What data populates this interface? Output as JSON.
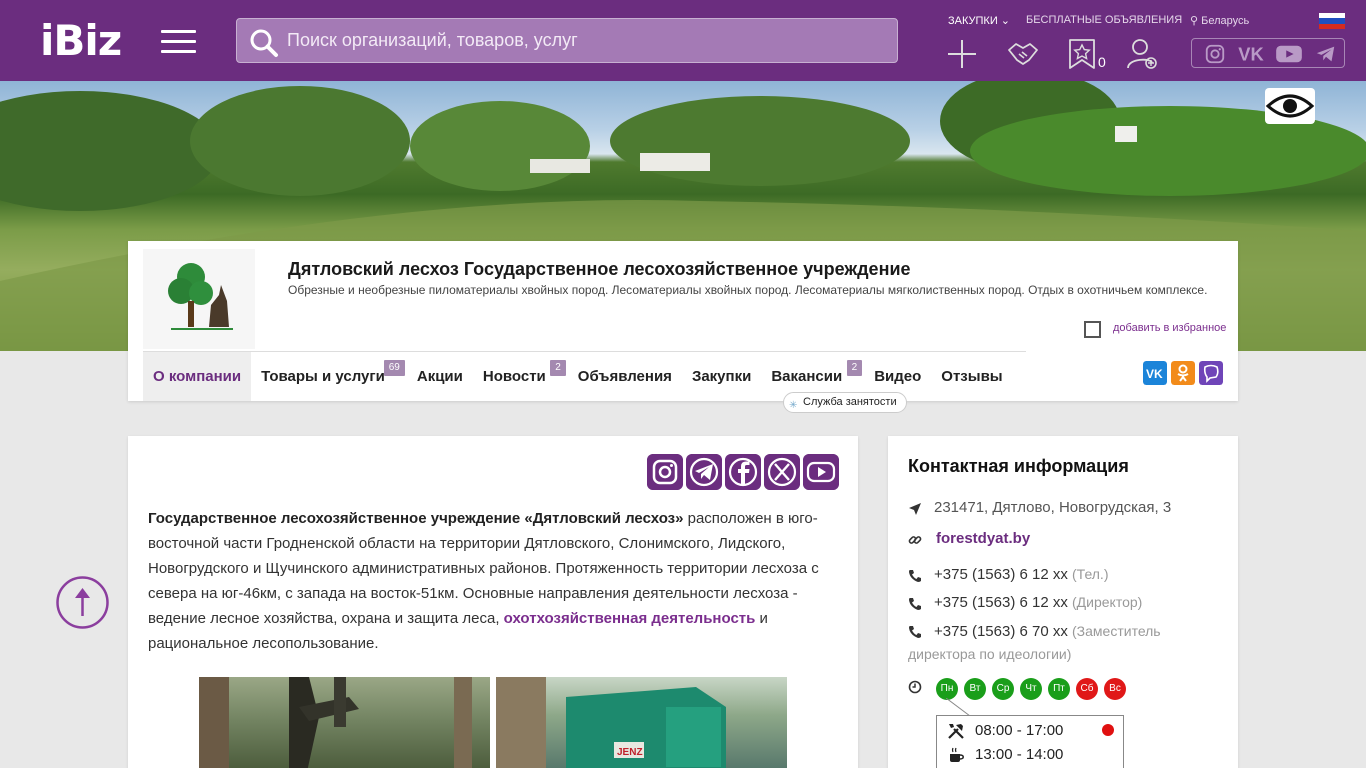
{
  "header": {
    "logo": "iBiz",
    "search_placeholder": "Поиск организаций, товаров, услуг",
    "links": {
      "purchases": "ЗАКУПКИ",
      "free_ads": "БЕСПЛАТНЫЕ ОБЪЯВЛЕНИЯ",
      "region": "Беларусь"
    },
    "favorites_count": "0",
    "socials": [
      "instagram-icon",
      "vk-icon",
      "youtube-icon",
      "telegram-icon"
    ]
  },
  "company": {
    "name": "Дятловский лесхоз Государственное лесохозяйственное учреждение",
    "description": "Обрезные и необрезные пиломатериалы хвойных пород. Лесоматериалы хвойных пород. Лесоматериалы мягколиственных пород. Отдых в охотничьем комплексе.",
    "add_favorite": "добавить в избранное",
    "employment_tag": "Служба занятости"
  },
  "nav": [
    {
      "label": "О компании",
      "badge": ""
    },
    {
      "label": "Товары и услуги",
      "badge": "69"
    },
    {
      "label": "Акции",
      "badge": ""
    },
    {
      "label": "Новости",
      "badge": "2"
    },
    {
      "label": "Объявления",
      "badge": ""
    },
    {
      "label": "Закупки",
      "badge": ""
    },
    {
      "label": "Вакансии",
      "badge": "2"
    },
    {
      "label": "Видео",
      "badge": ""
    },
    {
      "label": "Отзывы",
      "badge": ""
    }
  ],
  "about": {
    "bold": "Государственное лесохозяйственное учреждение «Дятловский лесхоз»",
    "text1": " расположен в юго-восточной части Гродненской области на территории Дятловского, Слонимского, Лидского, Новогрудского и Щучинского административных районов. Протяженность территории лесхоза с севера на юг-46км, с запада на восток-51км. Основные направления деятельности лесхоза - ведение лесное хозяйства, охрана и защита леса, ",
    "link": "охотхозяйственная деятельность",
    "text2": " и рациональное лесопользование."
  },
  "contacts": {
    "title": "Контактная информация",
    "address": "231471, Дятлово, Новогрудская, 3",
    "website": "forestdyat.by",
    "phones": [
      {
        "number": "+375 (1563) 6 12 xx",
        "note": "(Тел.)"
      },
      {
        "number": "+375 (1563) 6 12 xx",
        "note": "(Директор)"
      },
      {
        "number": "+375 (1563) 6 70 xx",
        "note": "(Заместитель директора по идеологии)"
      }
    ],
    "days": [
      {
        "label": "Пн",
        "open": true
      },
      {
        "label": "Вт",
        "open": true
      },
      {
        "label": "Ср",
        "open": true
      },
      {
        "label": "Чт",
        "open": true
      },
      {
        "label": "Пт",
        "open": true
      },
      {
        "label": "Сб",
        "open": false
      },
      {
        "label": "Вс",
        "open": false
      }
    ],
    "work_hours": "08:00 - 17:00",
    "lunch_hours": "13:00 - 14:00"
  },
  "colors": {
    "brand": "#6b2d7f",
    "open_day": "#1a9e1a",
    "closed_day": "#e01818"
  }
}
